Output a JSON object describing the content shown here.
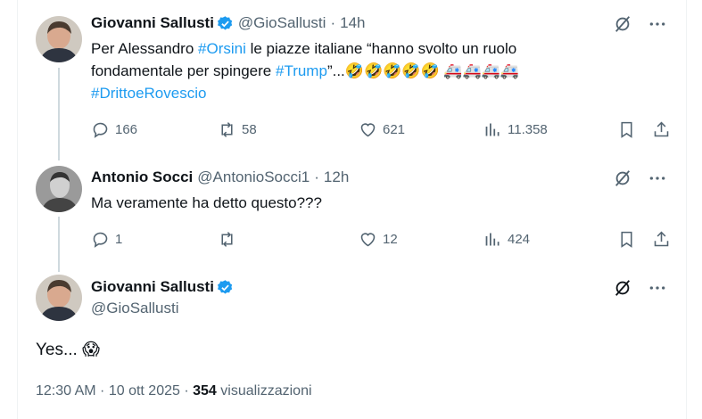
{
  "tweets": [
    {
      "name": "Giovanni Sallusti",
      "handle": "@GioSallusti",
      "time": "14h",
      "text": {
        "p1": "Per Alessandro ",
        "tag1": "#Orsini",
        "p2": " le piazze italiane “hanno svolto un ruolo",
        "p3": "fondamentale per spingere ",
        "tag2": "#Trump",
        "p4": "”...",
        "emojis": "🤣🤣🤣🤣🤣 🚑🚑🚑🚑",
        "tag3": "#DrittoeRovescio"
      },
      "replies": "166",
      "retweets": "58",
      "likes": "621",
      "views": "11.358"
    },
    {
      "name": "Antonio Socci",
      "handle": "@AntonioSocci1",
      "time": "12h",
      "text": "Ma veramente ha detto questo???",
      "replies": "1",
      "retweets": "",
      "likes": "12",
      "views": "424"
    }
  ],
  "main": {
    "name": "Giovanni Sallusti",
    "handle": "@GioSallusti",
    "text": "Yes... 😱",
    "timestamp": "12:30 AM · 10 ott 2025 · ",
    "views": "354",
    "views_label": " visualizzazioni"
  },
  "colors": {
    "accent": "#1d9bf0",
    "muted": "#536471"
  }
}
